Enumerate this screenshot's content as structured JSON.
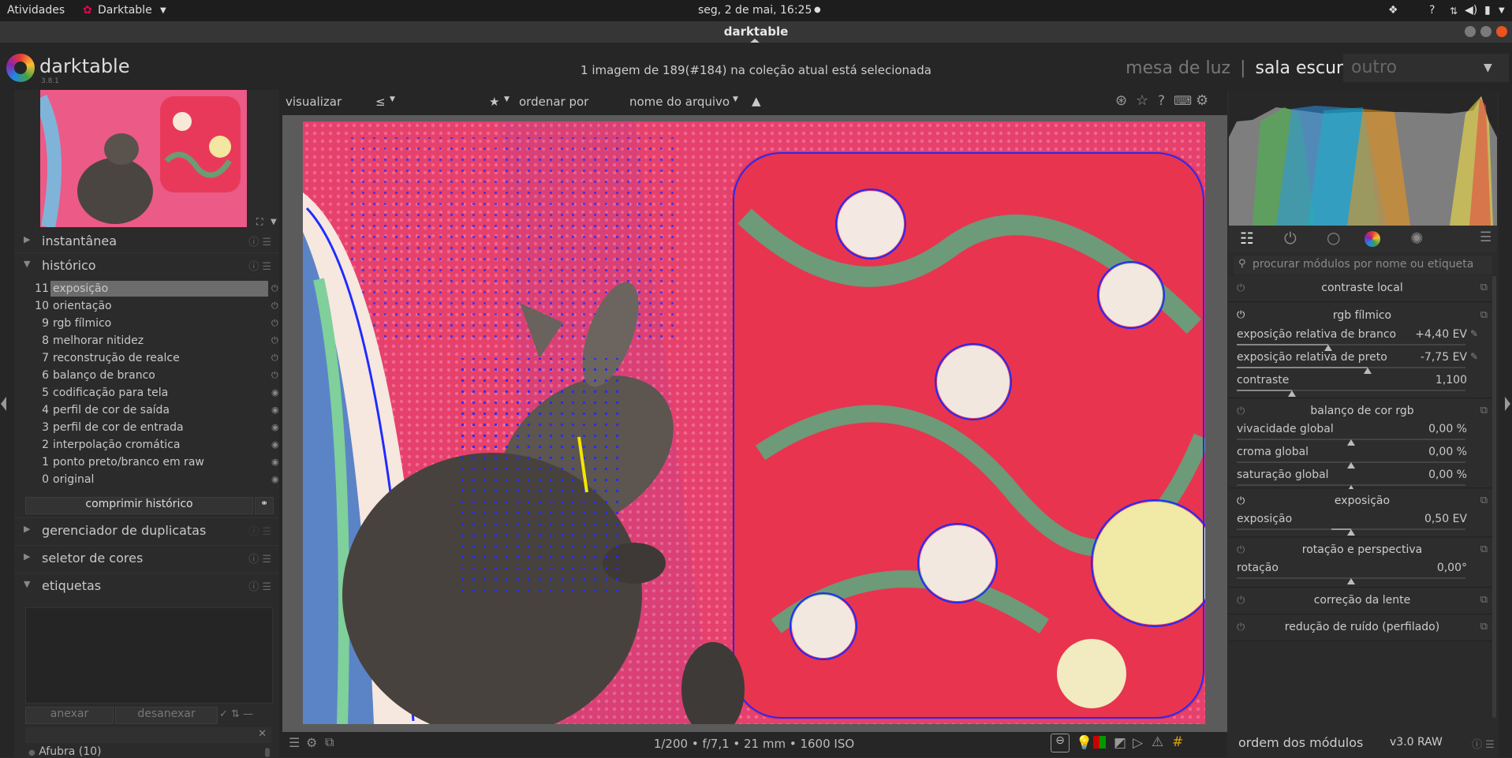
{
  "system_bar": {
    "activities": "Atividades",
    "app_menu": "Darktable",
    "clock": "seg,  2 de mai, 16:25"
  },
  "window": {
    "title": "darktable"
  },
  "header": {
    "brand": "darktable",
    "version": "3.8.1",
    "selection_info": "1 imagem de 189(#184) na coleção atual está selecionada",
    "views": {
      "lighttable": "mesa de luz",
      "darkroom": "sala escura",
      "other": "outro"
    },
    "separator": "|"
  },
  "left_panel": {
    "snapshots_label": "instantânea",
    "history_label": "histórico",
    "history_items": [
      {
        "n": "11",
        "label": "exposição"
      },
      {
        "n": "10",
        "label": "orientação"
      },
      {
        "n": "9",
        "label": "rgb fílmico"
      },
      {
        "n": "8",
        "label": "melhorar nitidez"
      },
      {
        "n": "7",
        "label": "reconstrução de realce"
      },
      {
        "n": "6",
        "label": "balanço de branco"
      },
      {
        "n": "5",
        "label": "codificação para tela"
      },
      {
        "n": "4",
        "label": "perfil de cor de saída"
      },
      {
        "n": "3",
        "label": "perfil de cor de entrada"
      },
      {
        "n": "2",
        "label": "interpolação cromática"
      },
      {
        "n": "1",
        "label": "ponto preto/branco em raw"
      },
      {
        "n": "0",
        "label": "original"
      }
    ],
    "compress_history": "comprimir histórico",
    "duplicates_label": "gerenciador de duplicatas",
    "color_picker_label": "seletor de cores",
    "tags_label": "etiquetas",
    "attach": "anexar",
    "detach": "desanexar",
    "tag_entry_first": "Afubra (10)"
  },
  "filter_bar": {
    "view_label": "visualizar",
    "view_op": "≤",
    "rating": "★",
    "sort_label": "ordenar por",
    "sort_value": "nome do arquivo",
    "sort_dir": "▲"
  },
  "bottom_bar": {
    "exif": "1/200 • f/7,1 • 21 mm • 1600 ISO"
  },
  "right_panel": {
    "search_placeholder": "procurar módulos por nome ou etiqueta",
    "modules": {
      "local_contrast": "contraste local",
      "filmic": "rgb fílmico",
      "filmic_white": "exposição relativa de branco",
      "filmic_white_val": "+4,40 EV",
      "filmic_black": "exposição relativa de preto",
      "filmic_black_val": "-7,75 EV",
      "filmic_contrast": "contraste",
      "filmic_contrast_val": "1,100",
      "color_balance": "balanço de cor rgb",
      "vibrance": "vivacidade global",
      "vibrance_val": "0,00 %",
      "chroma": "croma global",
      "chroma_val": "0,00 %",
      "saturation": "saturação global",
      "saturation_val": "0,00 %",
      "exposure": "exposição",
      "exposure_param": "exposição",
      "exposure_val": "0,50 EV",
      "rotate": "rotação e perspectiva",
      "rotation": "rotação",
      "rotation_val": "0,00°",
      "lens": "correção da lente",
      "denoise": "redução de ruído (perfilado)"
    },
    "module_order_label": "ordem dos módulos",
    "module_order_value": "v3.0 RAW"
  },
  "colors": {
    "selected_history_bg": "#6c6c6c",
    "overexposure": "#1f2bff",
    "photo_pink": "#e8436f"
  }
}
